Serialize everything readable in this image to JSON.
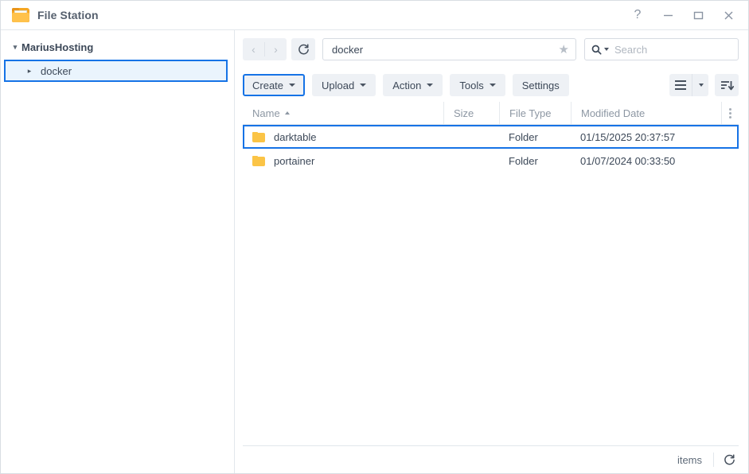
{
  "titlebar": {
    "app_icon": "folder-icon",
    "title": "File Station",
    "help_label": "?",
    "minimize_label": "minimize-icon",
    "maximize_label": "maximize-icon",
    "close_label": "close-icon"
  },
  "sidebar": {
    "root": {
      "label": "MariusHosting",
      "twisty": "▾"
    },
    "children": [
      {
        "label": "docker",
        "twisty": "▸",
        "selected": true
      }
    ]
  },
  "toolbar": {
    "back_label": "‹",
    "forward_label": "›",
    "refresh_label": "refresh-icon",
    "path_value": "docker",
    "path_placeholder": "",
    "favorite_label": "★",
    "search_placeholder": "Search",
    "search_value": "",
    "buttons": [
      {
        "label": "Create",
        "caret": true,
        "highlighted": true
      },
      {
        "label": "Upload",
        "caret": true,
        "highlighted": false
      },
      {
        "label": "Action",
        "caret": true,
        "highlighted": false
      },
      {
        "label": "Tools",
        "caret": true,
        "highlighted": false
      },
      {
        "label": "Settings",
        "caret": false,
        "highlighted": false
      }
    ],
    "view_label": "list-view-icon",
    "view_caret_label": "chevron-down-icon",
    "sort_label": "sort-descending-icon"
  },
  "table": {
    "columns": [
      {
        "label": "Name",
        "sorted": "asc"
      },
      {
        "label": "Size",
        "sorted": ""
      },
      {
        "label": "File Type",
        "sorted": ""
      },
      {
        "label": "Modified Date",
        "sorted": ""
      }
    ],
    "menu_label": "column-options-icon",
    "rows": [
      {
        "name": "darktable",
        "size": "",
        "file_type": "Folder",
        "modified_date": "01/15/2025 20:37:57",
        "selected": true
      },
      {
        "name": "portainer",
        "size": "",
        "file_type": "Folder",
        "modified_date": "01/07/2024 00:33:50",
        "selected": false
      }
    ]
  },
  "statusbar": {
    "items_text": "items",
    "refresh_label": "refresh-icon"
  },
  "colors": {
    "accent": "#1673e6",
    "folder": "#fbc446",
    "toolbar_button": "#eef1f5",
    "text": "#3c4858",
    "muted": "#8d97a3"
  }
}
